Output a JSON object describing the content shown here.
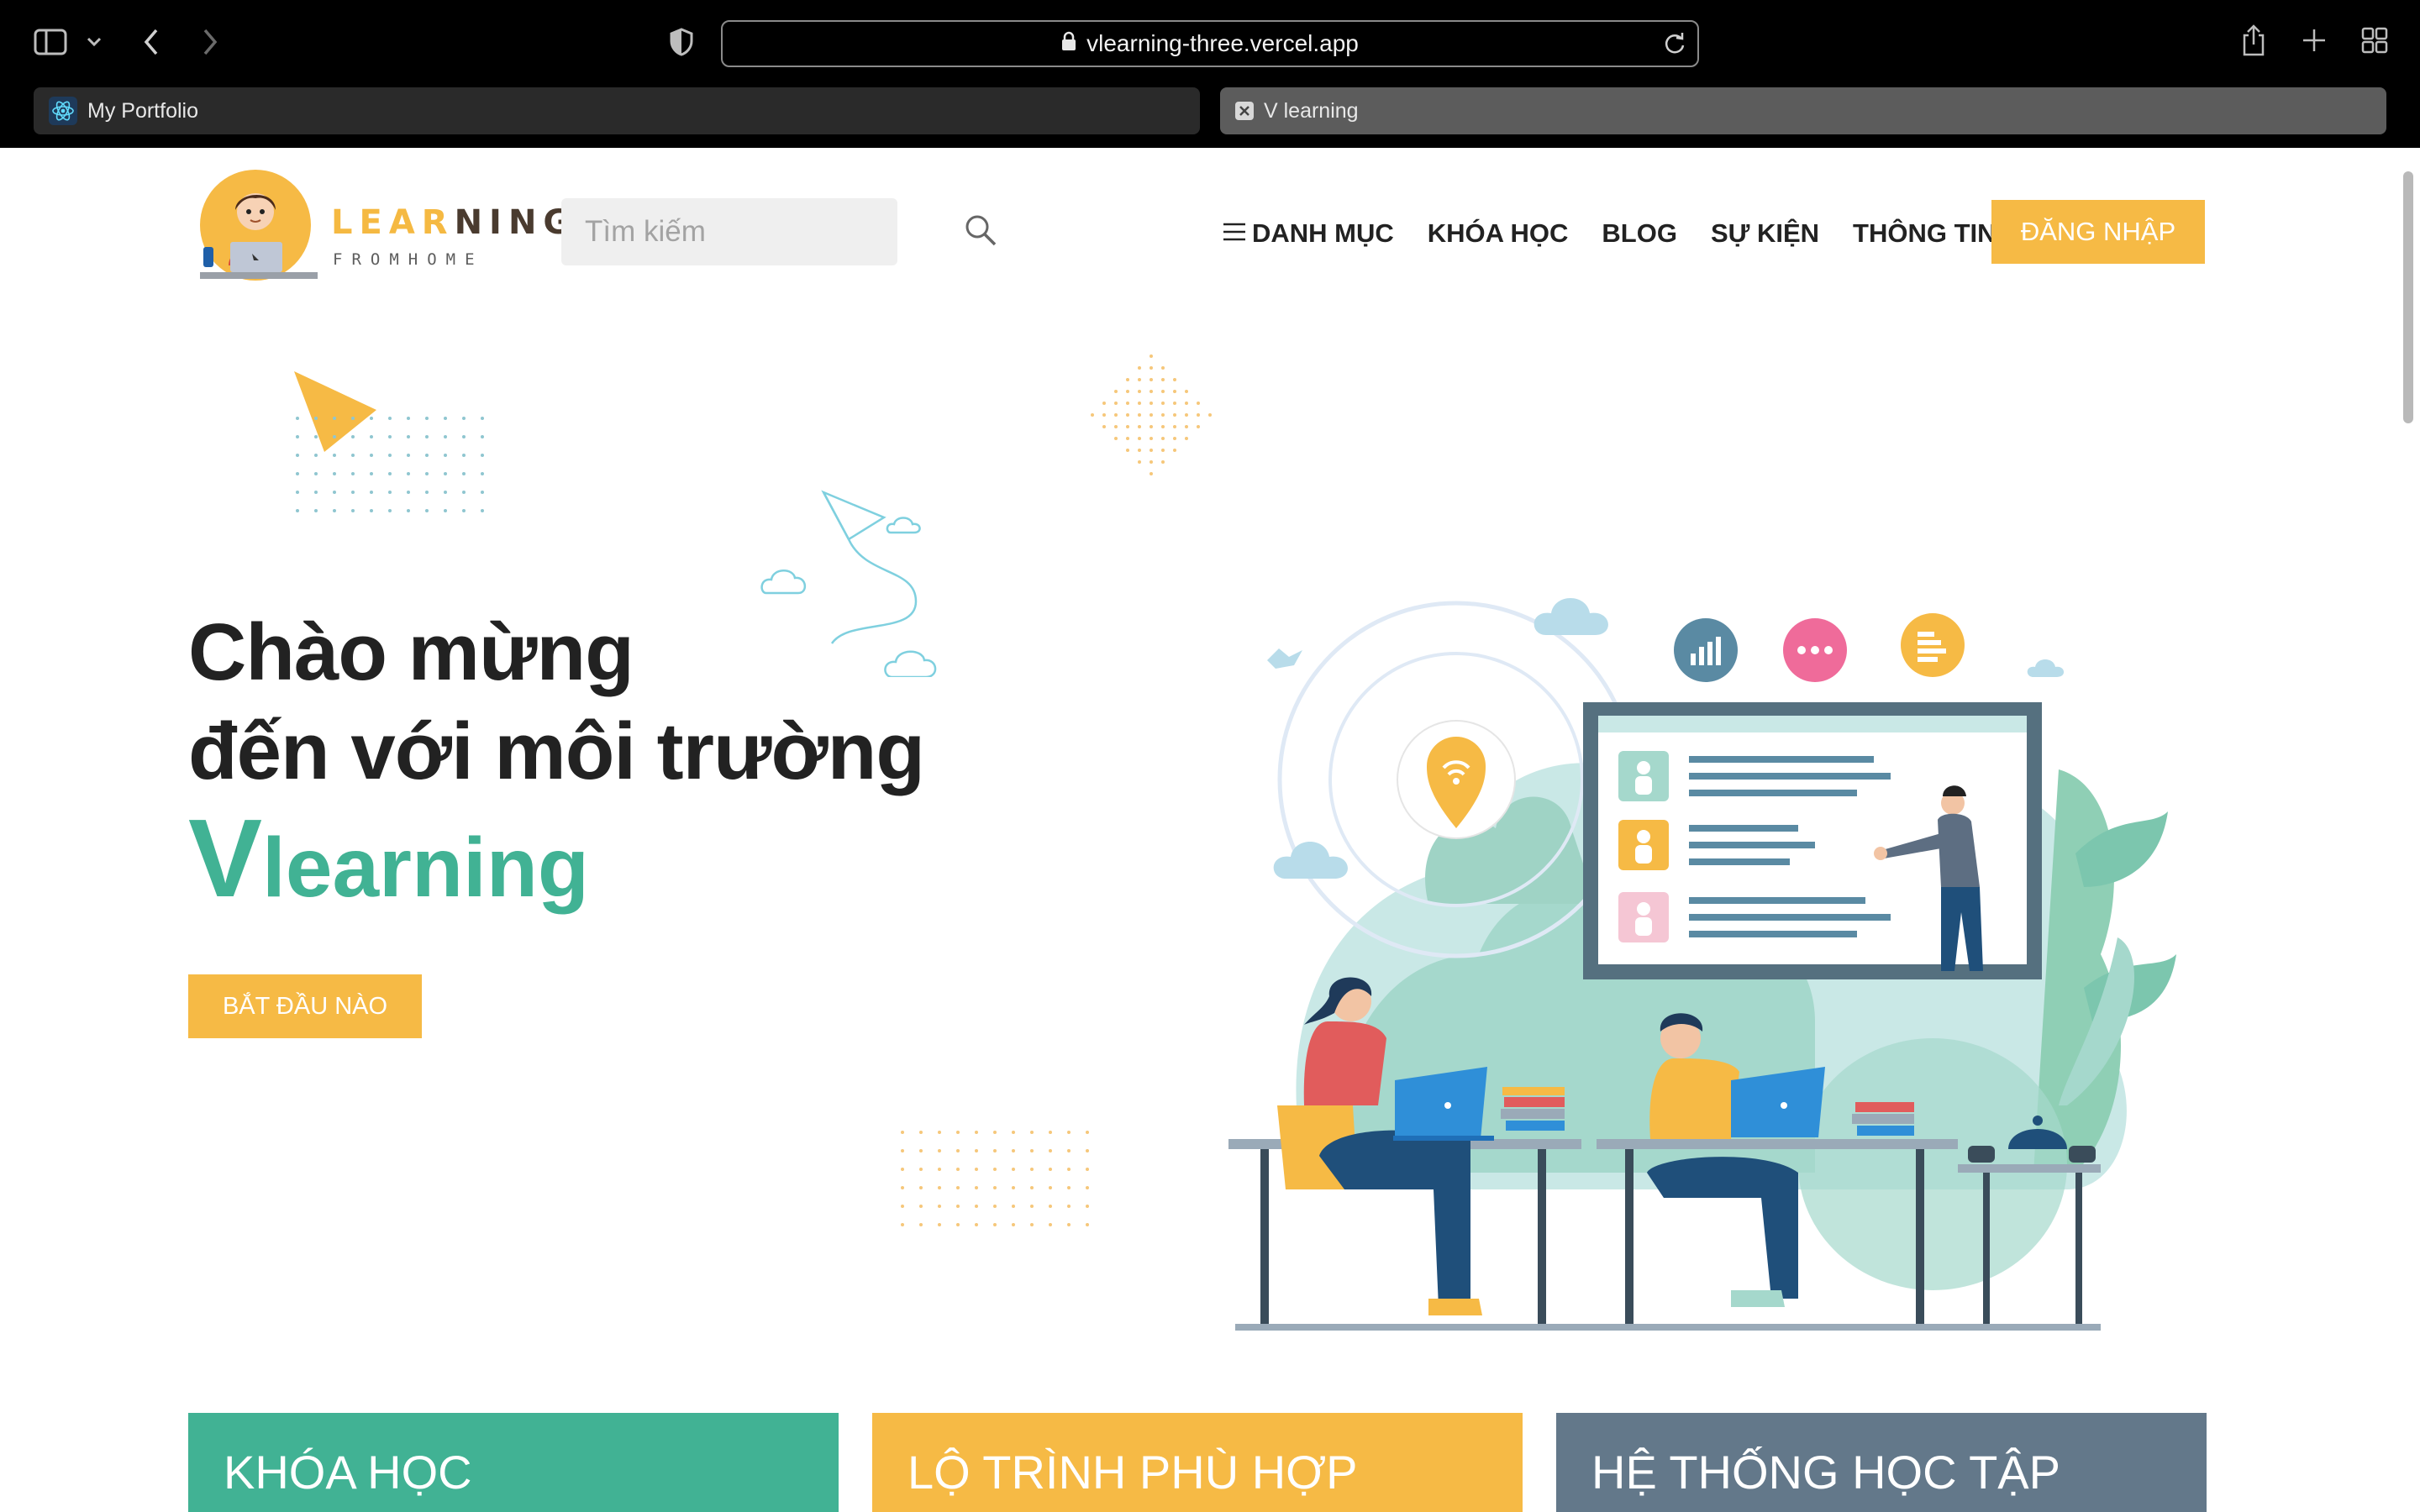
{
  "browser": {
    "url": "vlearning-three.vercel.app",
    "tabs": [
      {
        "label": "My Portfolio"
      },
      {
        "label": "V learning"
      }
    ]
  },
  "header": {
    "logo_word_1": "LEAR",
    "logo_word_2": "NING",
    "logo_sub": "FROMHOME",
    "search_placeholder": "Tìm kiếm",
    "nav": {
      "categories": "DANH MỤC",
      "courses": "KHÓA HỌC",
      "blog": "BLOG",
      "events": "SỰ KIỆN",
      "info": "THÔNG TIN"
    },
    "login": "ĐĂNG NHẬP"
  },
  "hero": {
    "line1": "Chào mừng",
    "line2": "đến với môi trường",
    "brand_v": "V",
    "brand_rest": "learning",
    "cta": "BẮT ĐẦU NÀO"
  },
  "cards": [
    {
      "title": "KHÓA HỌC"
    },
    {
      "title": "LỘ TRÌNH PHÙ HỢP"
    },
    {
      "title": "HỆ THỐNG HỌC TẬP"
    }
  ],
  "colors": {
    "accent_yellow": "#f6ba45",
    "accent_green": "#41b294",
    "slate": "#63788a"
  }
}
